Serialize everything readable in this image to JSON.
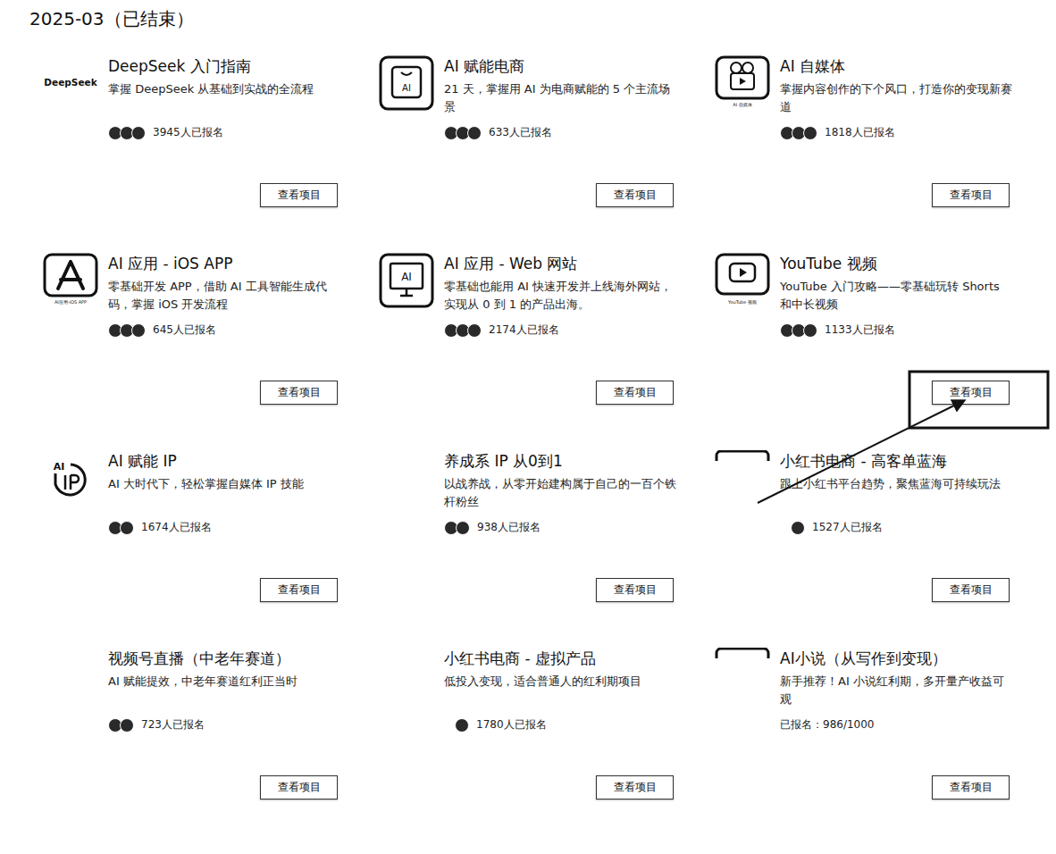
{
  "page": {
    "title": "2025-03（已结束）"
  },
  "cards": [
    {
      "title": "DeepSeek 入门指南",
      "desc": "掌握 DeepSeek 从基础到实战的全流程",
      "count": "3945人已报名",
      "avatars": 3,
      "button": "查看项目",
      "icon": {
        "kind": "deepseek",
        "label": "DeepSeek"
      }
    },
    {
      "title": "AI 赋能电商",
      "desc": "21 天，掌握用 AI 为电商赋能的 5 个主流场景",
      "count": "633人已报名",
      "avatars": 3,
      "button": "查看项目",
      "icon": {
        "kind": "bag",
        "label": "AI"
      }
    },
    {
      "title": "AI 自媒体",
      "desc": "掌握内容创作的下个风口，打造你的变现新赛道",
      "count": "1818人已报名",
      "avatars": 3,
      "button": "查看项目",
      "icon": {
        "kind": "camera",
        "label": "AI 自媒体"
      }
    },
    {
      "title": "AI 应用 - iOS APP",
      "desc": "零基础开发 APP，借助 AI 工具智能生成代码，掌握 iOS 开发流程",
      "count": "645人已报名",
      "avatars": 3,
      "button": "查看项目",
      "icon": {
        "kind": "appstore",
        "label": "AI应用-iOS APP"
      }
    },
    {
      "title": "AI 应用 - Web 网站",
      "desc": "零基础也能用 AI 快速开发并上线海外网站，实现从 0 到 1 的产品出海。",
      "count": "2174人已报名",
      "avatars": 3,
      "button": "查看项目",
      "icon": {
        "kind": "web",
        "label": "AI"
      }
    },
    {
      "title": "YouTube 视频",
      "desc": "YouTube 入门攻略——零基础玩转 Shorts 和中长视频",
      "count": "1133人已报名",
      "avatars": 3,
      "button": "查看项目",
      "icon": {
        "kind": "youtube",
        "label": "YouTube 视频"
      }
    },
    {
      "title": "AI 赋能 IP",
      "desc": "AI 大时代下，轻松掌握自媒体 IP 技能",
      "count": "1674人已报名",
      "avatars": 2,
      "button": "查看项目",
      "icon": {
        "kind": "aiip",
        "label": "AI"
      }
    },
    {
      "title": "养成系 IP 从0到1",
      "desc": "以战养战，从零开始建构属于自己的一百个铁杆粉丝",
      "count": "938人已报名",
      "avatars": 2,
      "button": "查看项目",
      "icon": {
        "kind": "none",
        "label": ""
      }
    },
    {
      "title": "小红书电商 - 高客单蓝海",
      "desc": "跟上小红书平台趋势，聚焦蓝海可持续玩法",
      "count": "1527人已报名",
      "avatars": 1,
      "button": "查看项目",
      "icon": {
        "kind": "bar",
        "label": ""
      }
    },
    {
      "title": "视频号直播（中老年赛道）",
      "desc": "AI 赋能提效，中老年赛道红利正当时",
      "count": "723人已报名",
      "avatars": 2,
      "button": "查看项目",
      "icon": {
        "kind": "none",
        "label": ""
      }
    },
    {
      "title": "小红书电商 - 虚拟产品",
      "desc": "低投入变现，适合普通人的红利期项目",
      "count": "1780人已报名",
      "avatars": 1,
      "button": "查看项目",
      "icon": {
        "kind": "none",
        "label": ""
      }
    },
    {
      "title": "AI小说（从写作到变现）",
      "desc": "新手推荐！AI 小说红利期，多开量产收益可观",
      "count": "已报名：986/1000",
      "avatars": 0,
      "button": "查看项目",
      "icon": {
        "kind": "bar",
        "label": ""
      }
    }
  ]
}
